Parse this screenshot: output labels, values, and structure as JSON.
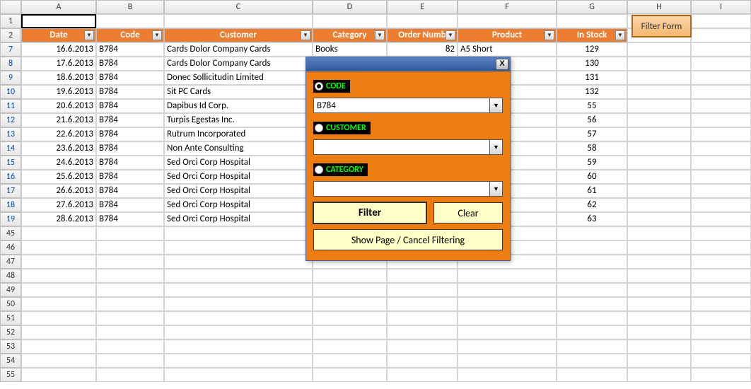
{
  "col_headers": [
    "A",
    "B",
    "C",
    "D",
    "E",
    "F",
    "G",
    "H",
    "I"
  ],
  "table_headers": {
    "date": "Date",
    "code": "Code",
    "customer": "Customer",
    "category": "Category",
    "order_num": "Order Numb",
    "product": "Product",
    "in_stock": "In Stock"
  },
  "rows": [
    {
      "r": "7",
      "date": "16.6.2013",
      "code": "B784",
      "customer": "Cards Dolor Company Cards",
      "category": "Books",
      "order_num": "82",
      "product": "A5 Short",
      "in_stock": "129"
    },
    {
      "r": "8",
      "date": "17.6.2013",
      "code": "B784",
      "customer": "Cards Dolor Company Cards",
      "category": "",
      "order_num": "",
      "product": "",
      "in_stock": "130"
    },
    {
      "r": "9",
      "date": "18.6.2013",
      "code": "B784",
      "customer": "Donec Sollicitudin Limited",
      "category": "",
      "order_num": "",
      "product": "",
      "in_stock": "131"
    },
    {
      "r": "10",
      "date": "19.6.2013",
      "code": "B784",
      "customer": "Sit PC Cards",
      "category": "",
      "order_num": "",
      "product": "",
      "in_stock": "132"
    },
    {
      "r": "11",
      "date": "20.6.2013",
      "code": "B784",
      "customer": "Dapibus Id Corp.",
      "category": "",
      "order_num": "",
      "product": "",
      "in_stock": "55"
    },
    {
      "r": "12",
      "date": "21.6.2013",
      "code": "B784",
      "customer": "Turpis Egestas Inc.",
      "category": "",
      "order_num": "",
      "product": "",
      "in_stock": "56"
    },
    {
      "r": "13",
      "date": "22.6.2013",
      "code": "B784",
      "customer": "Rutrum Incorporated",
      "category": "",
      "order_num": "",
      "product": "",
      "in_stock": "57"
    },
    {
      "r": "14",
      "date": "23.6.2013",
      "code": "B784",
      "customer": "Non Ante Consulting",
      "category": "",
      "order_num": "",
      "product": "",
      "in_stock": "58"
    },
    {
      "r": "15",
      "date": "24.6.2013",
      "code": "B784",
      "customer": "Sed Orci Corp Hospital",
      "category": "",
      "order_num": "",
      "product": "",
      "in_stock": "59"
    },
    {
      "r": "16",
      "date": "25.6.2013",
      "code": "B784",
      "customer": "Sed Orci Corp Hospital",
      "category": "",
      "order_num": "",
      "product": "",
      "in_stock": "60"
    },
    {
      "r": "17",
      "date": "26.6.2013",
      "code": "B784",
      "customer": "Sed Orci Corp Hospital",
      "category": "",
      "order_num": "",
      "product": "",
      "in_stock": "61"
    },
    {
      "r": "18",
      "date": "27.6.2013",
      "code": "B784",
      "customer": "Sed Orci Corp Hospital",
      "category": "",
      "order_num": "",
      "product": "",
      "in_stock": "62"
    },
    {
      "r": "19",
      "date": "28.6.2013",
      "code": "B784",
      "customer": "Sed Orci Corp Hospital",
      "category": "",
      "order_num": "",
      "product": "",
      "in_stock": "63"
    }
  ],
  "empty_row_numbers": [
    "45",
    "46",
    "47",
    "48",
    "49",
    "50",
    "51",
    "52",
    "53",
    "54",
    "55"
  ],
  "filter_form_button": "Filter Form",
  "dialog": {
    "close": "X",
    "group_code": "CODE",
    "group_customer": "CUSTOMER",
    "group_category": "CATEGORY",
    "code_value": "B784",
    "customer_value": "",
    "category_value": "",
    "filter_btn": "Filter",
    "clear_btn": "Clear",
    "show_btn": "Show Page / Cancel Filtering"
  }
}
